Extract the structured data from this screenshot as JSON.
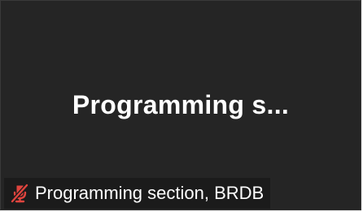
{
  "tile": {
    "display_name": "Programming  s...",
    "name_label": "Programming section, BRDB",
    "mic_status_icon": "microphone-muted-icon"
  },
  "colors": {
    "tile_background": "#252525",
    "label_background": "#1b1b1b",
    "text": "#ffffff",
    "muted_icon": "#e0443e"
  }
}
